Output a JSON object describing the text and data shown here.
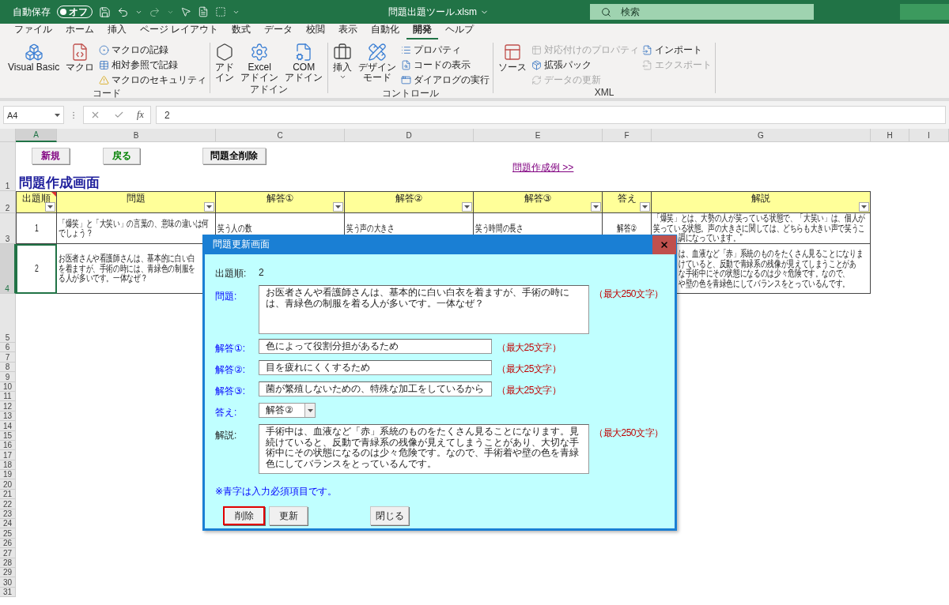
{
  "titlebar": {
    "autosave_label": "自動保存",
    "autosave_toggle": {
      "label": "オフ",
      "on": false
    },
    "title": "問題出題ツール.xlsm",
    "search": {
      "placeholder": "検索"
    }
  },
  "ribbon": {
    "tabs": [
      {
        "label": "ファイル",
        "selected": false
      },
      {
        "label": "ホーム",
        "selected": false
      },
      {
        "label": "挿入",
        "selected": false
      },
      {
        "label": "ページ レイアウト",
        "selected": false
      },
      {
        "label": "数式",
        "selected": false
      },
      {
        "label": "データ",
        "selected": false
      },
      {
        "label": "校閲",
        "selected": false
      },
      {
        "label": "表示",
        "selected": false
      },
      {
        "label": "自動化",
        "selected": false
      },
      {
        "label": "開発",
        "selected": true
      },
      {
        "label": "ヘルプ",
        "selected": false
      }
    ],
    "groups": [
      {
        "label": "コード",
        "items": [
          {
            "kind": "large",
            "label_lines": [
              "Visual Basic"
            ],
            "dropdown": false
          },
          {
            "kind": "large",
            "label_lines": [
              "マクロ"
            ],
            "dropdown": false
          },
          {
            "kind": "stack",
            "entries": [
              {
                "label": "マクロの記録",
                "disabled": false
              },
              {
                "label": "相対参照で記録",
                "disabled": false
              },
              {
                "label": "マクロのセキュリティ",
                "disabled": false
              }
            ]
          }
        ]
      },
      {
        "label": "アドイン",
        "items": [
          {
            "kind": "large",
            "label_lines": [
              "アド",
              "イン"
            ],
            "dropdown": false
          },
          {
            "kind": "large",
            "label_lines": [
              "Excel",
              "アドイン"
            ],
            "dropdown": false
          },
          {
            "kind": "large",
            "label_lines": [
              "COM",
              "アドイン"
            ],
            "dropdown": false
          }
        ]
      },
      {
        "label": "コントロール",
        "items": [
          {
            "kind": "large",
            "label_lines": [
              "挿入"
            ],
            "dropdown": true
          },
          {
            "kind": "large",
            "label_lines": [
              "デザイン",
              "モード"
            ],
            "dropdown": false
          },
          {
            "kind": "stack",
            "entries": [
              {
                "label": "プロパティ",
                "disabled": false
              },
              {
                "label": "コードの表示",
                "disabled": false
              },
              {
                "label": "ダイアログの実行",
                "disabled": false
              }
            ]
          }
        ]
      },
      {
        "label": "XML",
        "items": [
          {
            "kind": "large",
            "label_lines": [
              "ソース"
            ],
            "dropdown": false
          },
          {
            "kind": "stack",
            "entries": [
              {
                "label": "対応付けのプロパティ",
                "disabled": true
              },
              {
                "label": "拡張パック",
                "disabled": false
              },
              {
                "label": "データの更新",
                "disabled": true
              }
            ]
          },
          {
            "kind": "stack",
            "entries": [
              {
                "label": "インポート",
                "disabled": false
              },
              {
                "label": "エクスポート",
                "disabled": true
              }
            ]
          }
        ]
      }
    ]
  },
  "formula_bar": {
    "name_box": "A4",
    "function_button": "fx",
    "formula": "2"
  },
  "sheet": {
    "columns": [
      {
        "label": "A",
        "selected": true
      },
      {
        "label": "B",
        "selected": false
      },
      {
        "label": "C",
        "selected": false
      },
      {
        "label": "D",
        "selected": false
      },
      {
        "label": "E",
        "selected": false
      },
      {
        "label": "F",
        "selected": false
      },
      {
        "label": "G",
        "selected": false
      },
      {
        "label": "H",
        "selected": false
      },
      {
        "label": "I",
        "selected": false
      }
    ],
    "row1": {
      "label": "1",
      "selected": false,
      "buttons": [
        {
          "label": "新規",
          "color": "#800080"
        },
        {
          "label": "戻る",
          "color": "#008000"
        },
        {
          "label": "問題全削除",
          "color": "#000000"
        }
      ],
      "link": "問題作成例 >>",
      "title": "問題作成画面"
    },
    "header_row": {
      "label": "2",
      "selected": false,
      "cells": [
        {
          "text": "出題順",
          "comment": true
        },
        {
          "text": "問題",
          "comment": false
        },
        {
          "text": "解答①",
          "comment": false
        },
        {
          "text": "解答②",
          "comment": false
        },
        {
          "text": "解答③",
          "comment": false
        },
        {
          "text": "答え",
          "comment": false
        },
        {
          "text": "解説",
          "comment": false
        }
      ]
    },
    "data_rows": [
      {
        "label": "3",
        "selected": false,
        "cells": [
          {
            "lines": [
              "1"
            ]
          },
          {
            "lines": [
              "「爆笑」と「大笑い」の言葉の、意味の違いは何",
              "でしょう？"
            ]
          },
          {
            "lines": [
              "笑う人の数"
            ]
          },
          {
            "lines": [
              "笑う声の大きさ"
            ]
          },
          {
            "lines": [
              "笑う時間の長さ"
            ]
          },
          {
            "lines": [
              "解答②"
            ]
          },
          {
            "lines": [
              "「爆笑」とは、大勢の人が笑っている状態で、「大笑い」は、個人が",
              "笑っている状態。声の大きさに関しては、どちらも大きい声で笑うこ"
            ],
            "covered_lines": [
              "調になっています。”"
            ]
          }
        ]
      },
      {
        "label": "4",
        "selected": true,
        "cells": [
          {
            "lines": [
              "2"
            ]
          },
          {
            "lines": [
              "お医者さんや看護師さんは、基本的に白い白",
              "を着ますが、手術の時には、青緑色の制服を",
              "る人が多いです。一体なぜ？"
            ]
          },
          {},
          {},
          {},
          {},
          {
            "covered_lines": [
              "は、血液など「赤」系統のものをたくさん見ることになりま",
              "けていると、反動で青緑系の残像が見えてしまうことがあ",
              "な手術中にその状態になるのは少々危険です。なので、",
              "や壁の色を青緑色にしてバランスをとっているんです。"
            ]
          }
        ]
      }
    ],
    "empty_rows": [
      {
        "label": "5",
        "selected": false
      },
      {
        "label": "6",
        "selected": false
      },
      {
        "label": "7",
        "selected": false
      },
      {
        "label": "8",
        "selected": false
      },
      {
        "label": "9",
        "selected": false
      },
      {
        "label": "10",
        "selected": false
      },
      {
        "label": "11",
        "selected": false
      },
      {
        "label": "12",
        "selected": false
      },
      {
        "label": "13",
        "selected": false
      },
      {
        "label": "14",
        "selected": false
      },
      {
        "label": "15",
        "selected": false
      },
      {
        "label": "16",
        "selected": false
      },
      {
        "label": "17",
        "selected": false
      },
      {
        "label": "18",
        "selected": false
      },
      {
        "label": "19",
        "selected": false
      },
      {
        "label": "20",
        "selected": false
      },
      {
        "label": "21",
        "selected": false
      },
      {
        "label": "22",
        "selected": false
      },
      {
        "label": "23",
        "selected": false
      },
      {
        "label": "24",
        "selected": false
      },
      {
        "label": "25",
        "selected": false
      },
      {
        "label": "26",
        "selected": false
      },
      {
        "label": "27",
        "selected": false
      },
      {
        "label": "28",
        "selected": false
      },
      {
        "label": "29",
        "selected": false
      },
      {
        "label": "30",
        "selected": false
      },
      {
        "label": "31",
        "selected": false
      }
    ]
  },
  "dialog": {
    "title": "問題更新画面",
    "fields": [
      {
        "kind": "display",
        "label": "出題順:",
        "value": "2",
        "required": false
      },
      {
        "kind": "textarea",
        "label": "問題:",
        "value": "お医者さんや看護師さんは、基本的に白い白衣を着ますが、手術の時には、青緑色の制服を着る人が多いです。一体なぜ？",
        "hint": "（最大250文字）",
        "required": true
      },
      {
        "kind": "input",
        "label": "解答①:",
        "value": "色によって役割分担があるため",
        "hint": "（最大25文字）",
        "required": true
      },
      {
        "kind": "input",
        "label": "解答②:",
        "value": "目を疲れにくくするため",
        "hint": "（最大25文字）",
        "required": true
      },
      {
        "kind": "input",
        "label": "解答③:",
        "value": "菌が繁殖しないための、特殊な加工をしているから",
        "hint": "（最大25文字）",
        "required": true
      },
      {
        "kind": "select",
        "label": "答え:",
        "value": "解答②",
        "required": true
      },
      {
        "kind": "textarea",
        "label": "解説:",
        "value": "手術中は、血液など「赤」系統のものをたくさん見ることになります。見続けていると、反動で青緑系の残像が見えてしまうことがあり、大切な手術中にその状態になるのは少々危険です。なので、手術着や壁の色を青緑色にしてバランスをとっているんです。",
        "hint": "（最大250文字）",
        "required": false
      }
    ],
    "note": "※青字は入力必須項目です。",
    "buttons": [
      {
        "label": "削除",
        "focused": true
      },
      {
        "label": "更新",
        "focused": false
      },
      {
        "label": "閉じる",
        "focused": false
      }
    ]
  }
}
